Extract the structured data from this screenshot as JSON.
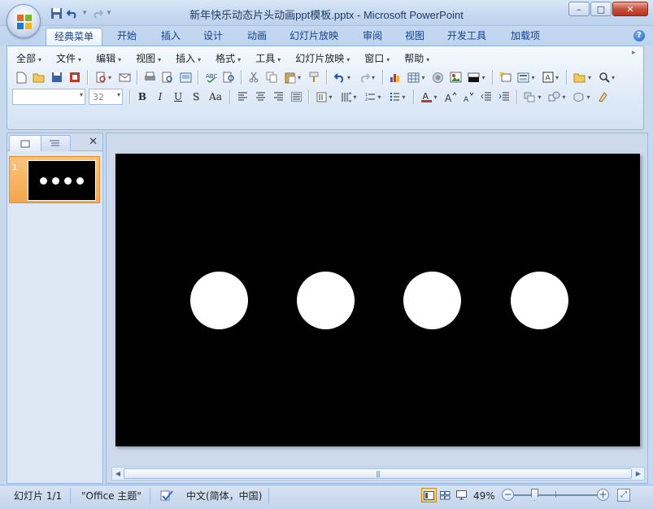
{
  "window": {
    "title": "新年快乐动态片头动画ppt模板.pptx - Microsoft PowerPoint",
    "controls": {
      "minimize": "–",
      "maximize": "□",
      "close": "✕"
    }
  },
  "ribbon_tabs": [
    {
      "label": "经典菜单",
      "active": true
    },
    {
      "label": "开始"
    },
    {
      "label": "插入"
    },
    {
      "label": "设计"
    },
    {
      "label": "动画"
    },
    {
      "label": "幻灯片放映"
    },
    {
      "label": "审阅"
    },
    {
      "label": "视图"
    },
    {
      "label": "开发工具"
    },
    {
      "label": "加载项"
    }
  ],
  "classic_menu": [
    {
      "label": "全部"
    },
    {
      "label": "文件"
    },
    {
      "label": "编辑"
    },
    {
      "label": "视图"
    },
    {
      "label": "插入"
    },
    {
      "label": "格式"
    },
    {
      "label": "工具"
    },
    {
      "label": "幻灯片放映"
    },
    {
      "label": "窗口"
    },
    {
      "label": "帮助"
    }
  ],
  "format_bar": {
    "font_name": "",
    "font_size": "32",
    "bold": "B",
    "italic": "I",
    "underline": "U",
    "shadow": "S",
    "change_case": "Aa"
  },
  "slides_pane": {
    "slide_number": "1"
  },
  "slide": {
    "background": "#000000",
    "dot_color": "#ffffff",
    "dot_count": 4
  },
  "status_bar": {
    "slide_info": "幻灯片 1/1",
    "theme": "\"Office 主题\"",
    "language": "中文(简体，中国)",
    "zoom": "49%"
  },
  "colors": {
    "accent_orange": "#f5a74a",
    "ribbon_blue": "#15428b"
  }
}
